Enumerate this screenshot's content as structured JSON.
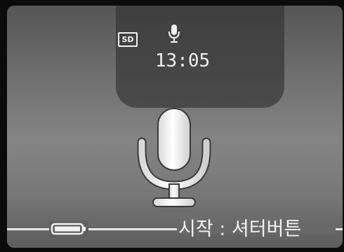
{
  "status": {
    "storage_label": "SD",
    "time": "13:05"
  },
  "icons": {
    "storage": "sd-card-icon",
    "mode": "microphone-icon",
    "center": "microphone-icon",
    "battery": "battery-full-icon"
  },
  "battery": {
    "level": 1.0
  },
  "hint": {
    "text": "시작 : 셔터버튼"
  },
  "colors": {
    "panel": "#7a7a7a",
    "notch": "#454545",
    "text": "#f2f2f2"
  }
}
